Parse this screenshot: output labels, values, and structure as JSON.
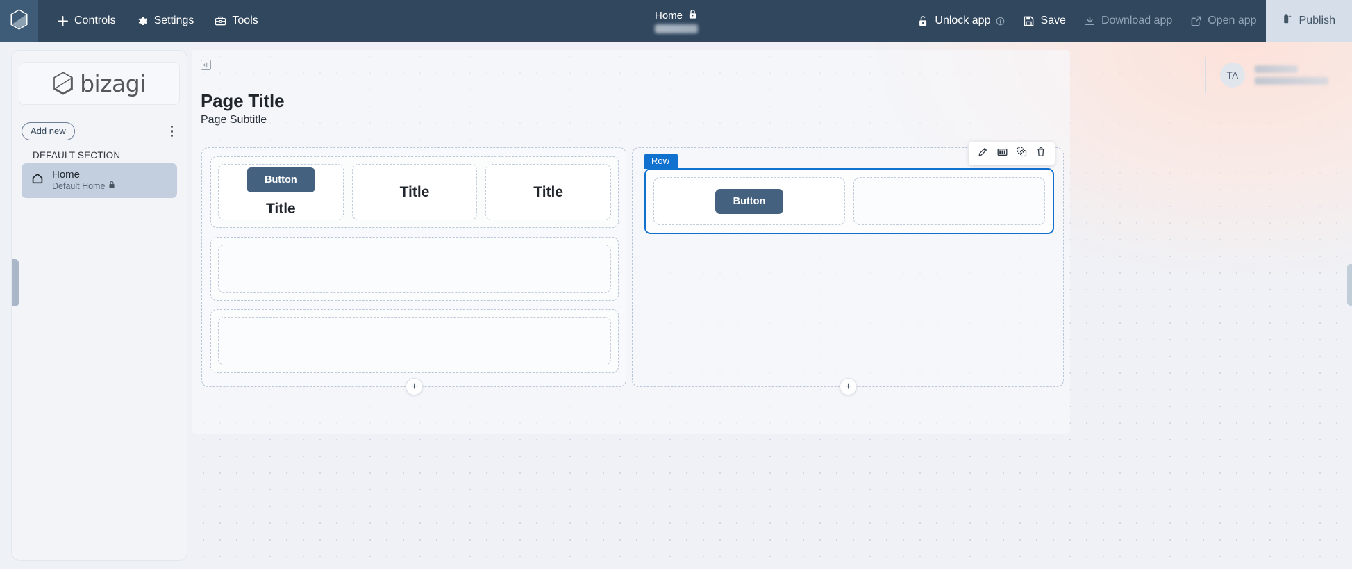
{
  "topbar": {
    "logo_icon": "bizagi-hex-logo-icon",
    "left_items": [
      {
        "label": "Controls",
        "icon": "plus-icon"
      },
      {
        "label": "Settings",
        "icon": "gear-icon"
      },
      {
        "label": "Tools",
        "icon": "toolbox-icon"
      }
    ],
    "center": {
      "title": "Home",
      "lock_icon": "lock-icon",
      "redacted_subtitle": ""
    },
    "right_items": [
      {
        "label": "Unlock app",
        "icon": "unlock-icon",
        "dim": false,
        "info_icon": "info-icon"
      },
      {
        "label": "Save",
        "icon": "floppy-disk-icon",
        "dim": false
      },
      {
        "label": "Download app",
        "icon": "download-icon",
        "dim": true
      },
      {
        "label": "Open app",
        "icon": "external-link-icon",
        "dim": true
      }
    ],
    "publish": {
      "label": "Publish",
      "icon": "publish-icon"
    }
  },
  "sidebar": {
    "logo_word": "bizagi",
    "logo_mark_icon": "bizagi-hex-mark-icon",
    "add_new_label": "Add new",
    "kebab_icon": "more-vertical-icon",
    "section_label": "DEFAULT SECTION",
    "nav_items": [
      {
        "title": "Home",
        "subtitle": "Default Home",
        "icon": "home-icon",
        "lock_icon": "lock-icon",
        "active": true
      }
    ]
  },
  "canvas": {
    "collapse_icon": "collapse-panel-icon",
    "page_title": "Page Title",
    "page_subtitle": "Page Subtitle",
    "avatar_initials": "TA",
    "left_column": {
      "row1": {
        "cells": [
          {
            "type": "stack",
            "button_label": "Button",
            "title_label": "Title"
          },
          {
            "type": "title",
            "title_label": "Title"
          },
          {
            "type": "title",
            "title_label": "Title"
          }
        ]
      },
      "row2": {
        "cells": [
          {
            "type": "empty"
          }
        ]
      },
      "row3": {
        "cells": [
          {
            "type": "empty"
          }
        ]
      },
      "add_label": "+"
    },
    "right_column": {
      "selected_row": {
        "badge_label": "Row",
        "toolbar": [
          {
            "icon": "pencil-edit-icon",
            "name": "edit-row-button"
          },
          {
            "icon": "columns-icon",
            "name": "columns-row-button"
          },
          {
            "icon": "duplicate-icon",
            "name": "duplicate-row-button"
          },
          {
            "icon": "trash-icon",
            "name": "delete-row-button"
          }
        ],
        "cells": [
          {
            "type": "button",
            "button_label": "Button"
          },
          {
            "type": "empty"
          }
        ]
      },
      "add_label": "+"
    }
  },
  "colors": {
    "topbar_bg": "#31475e",
    "publish_bg": "#d6dfe9",
    "selection_blue": "#1171cf",
    "widget_button": "#44627f",
    "nav_active": "#c3cfdf"
  }
}
